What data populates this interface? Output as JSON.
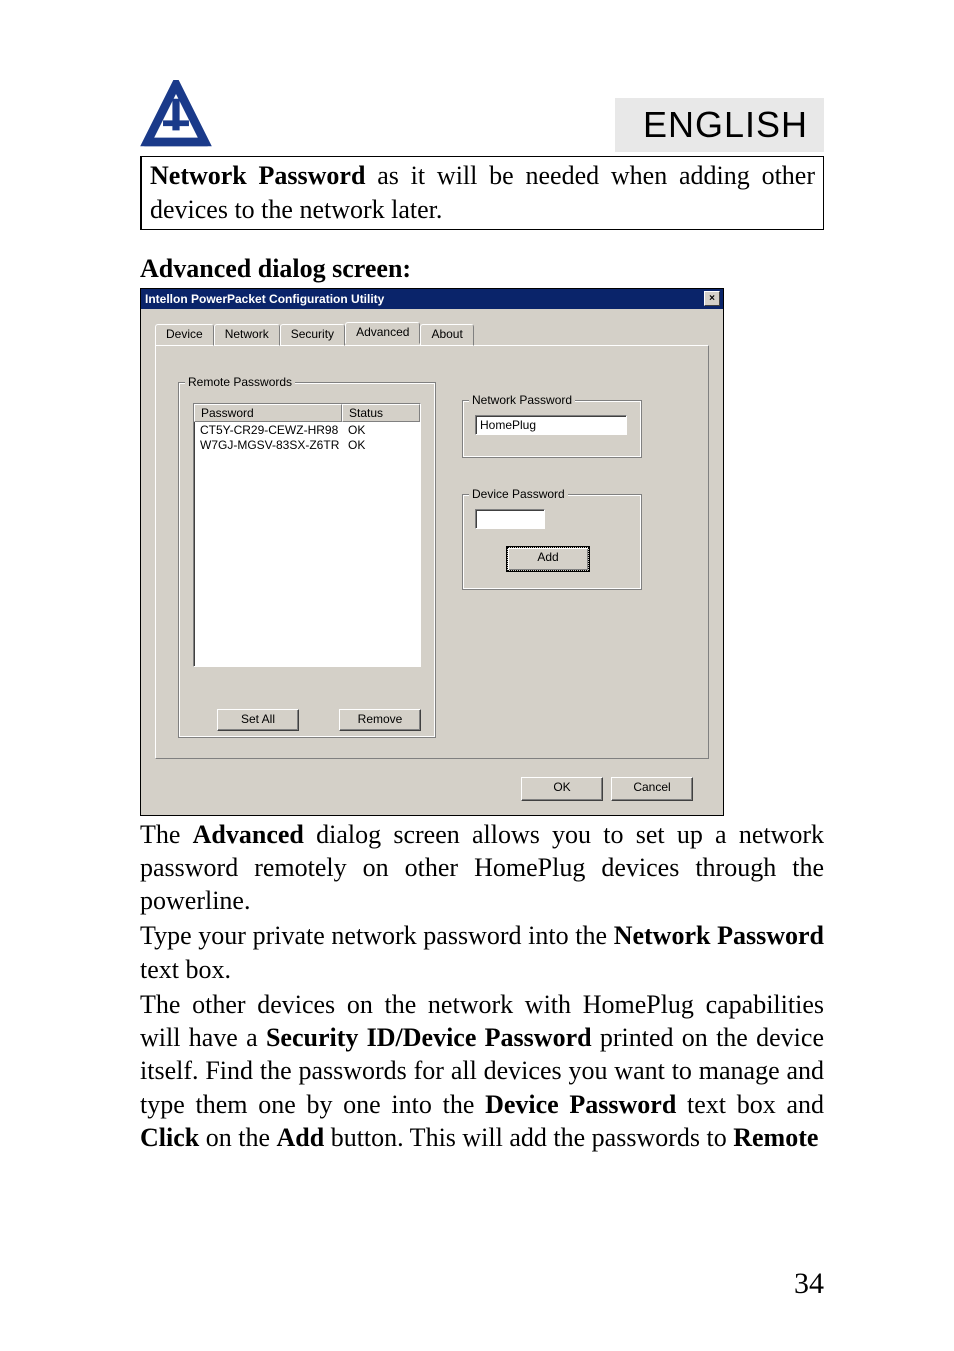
{
  "header": {
    "language_label": "ENGLISH"
  },
  "note": {
    "text_prefix": "",
    "bold1": "Network Password",
    "text_mid": " as it will be needed when adding other devices to the network later."
  },
  "section_title": "Advanced dialog screen:",
  "dialog": {
    "title": "Intellon PowerPacket Configuration Utility",
    "close": "×",
    "tabs": [
      "Device",
      "Network",
      "Security",
      "Advanced",
      "About"
    ],
    "active_tab": 3,
    "remote_passwords_label": "Remote Passwords",
    "list_headers": {
      "password": "Password",
      "status": "Status"
    },
    "list_rows": [
      {
        "password": "CT5Y-CR29-CEWZ-HR98",
        "status": "OK"
      },
      {
        "password": "W7GJ-MGSV-83SX-Z6TR",
        "status": "OK"
      }
    ],
    "buttons": {
      "set_all": "Set All",
      "remove": "Remove",
      "add": "Add",
      "ok": "OK",
      "cancel": "Cancel"
    },
    "network_password_label": "Network Password",
    "network_password_value": "HomePlug",
    "device_password_label": "Device Password",
    "device_password_value": ""
  },
  "paragraphs": {
    "p1a": "The ",
    "p1b": "Advanced",
    "p1c": " dialog screen allows you to set up a network password remotely on other HomePlug devices through the powerline.",
    "p2a": "Type your private network password into the ",
    "p2b": "Network Password",
    "p2c": " text box.",
    "p3a": "The other devices on the network with HomePlug capabilities will have a ",
    "p3b": "Security ID/Device Password",
    "p3c": " printed on the device itself. Find the passwords for all devices you want to manage and type them one by one into the ",
    "p3d": "Device Password",
    "p3e": " text box and ",
    "p3f": "Click",
    "p3g": " on the ",
    "p3h": "Add",
    "p3i": " button. This will add the passwords to ",
    "p3j": "Remote"
  },
  "page_number": "34"
}
